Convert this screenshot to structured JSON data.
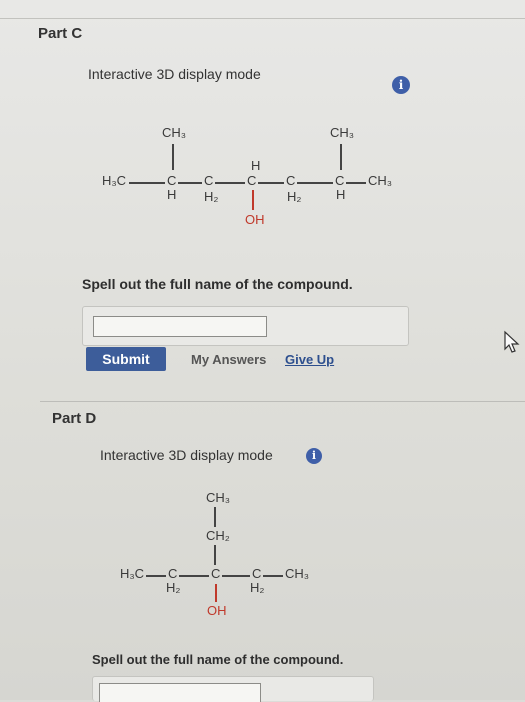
{
  "part_c": {
    "title": "Part C",
    "mode_label": "Interactive 3D display mode",
    "info_icon": "info-icon",
    "question": "Spell out the full name of the compound.",
    "answer_value": "",
    "submit_label": "Submit",
    "my_answers_label": "My Answers",
    "give_up_label": "Give Up",
    "structure": {
      "ch3_left_top": "CH₃",
      "ch3_right_top": "CH₃",
      "h3c": "H₃C",
      "c1": "C",
      "c2": "C",
      "c3": "C",
      "c4": "C",
      "c5": "C",
      "ch3_right": "CH₃",
      "h_under_c1": "H",
      "h2_under_c2": "H₂",
      "h_above_c3": "H",
      "oh": "OH",
      "h2_under_c4": "H₂",
      "h_under_c5": "H"
    }
  },
  "part_d": {
    "title": "Part D",
    "mode_label": "Interactive 3D display mode",
    "info_icon": "info-icon",
    "question": "Spell out the full name of the compound.",
    "answer_value": "",
    "structure": {
      "ch3_top": "CH₃",
      "ch2": "CH₂",
      "h3c": "H₃C",
      "c1": "C",
      "c2": "C",
      "c3": "C",
      "ch3_right": "CH₃",
      "h2_under_c1": "H₂",
      "oh": "OH",
      "h2_under_c3": "H₂"
    }
  },
  "colors": {
    "accent": "#3d5d9a",
    "oh_red": "#c0392b"
  }
}
